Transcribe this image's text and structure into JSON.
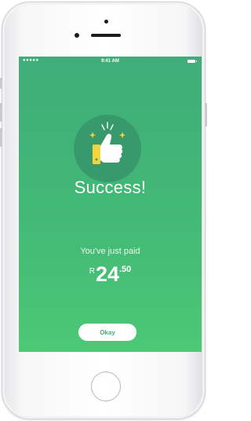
{
  "status_bar": {
    "signal": "●●●●●",
    "time": "9:41 AM",
    "battery_icon": "battery-icon"
  },
  "success": {
    "icon": "thumbs-up-icon",
    "title": "Success!",
    "subtitle": "You've just paid",
    "currency": "R",
    "amount_main": "24",
    "amount_cents": ".50"
  },
  "actions": {
    "okay_label": "Okay"
  },
  "colors": {
    "gradient_top": "#3fad78",
    "gradient_bottom": "#4cc875",
    "icon_circle": "#37966a",
    "thumb_white": "#ffffff",
    "cuff_yellow": "#f5d33a",
    "sparkle_yellow": "#f5d33a"
  }
}
